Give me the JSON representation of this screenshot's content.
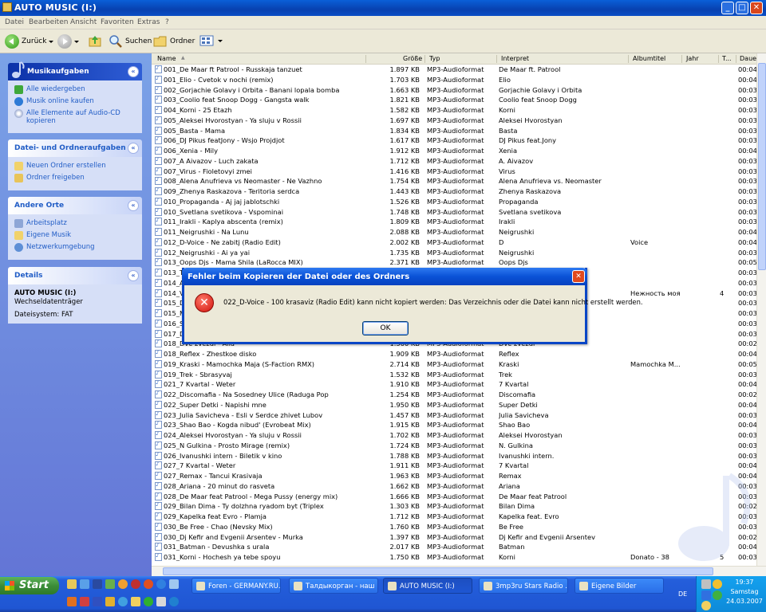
{
  "window": {
    "title": "AUTO MUSIC (I:)",
    "min": "_",
    "max": "□",
    "close": "✕"
  },
  "menu": [
    "Datei",
    "Bearbeiten",
    "Ansicht",
    "Favoriten",
    "Extras",
    "?"
  ],
  "toolbar": {
    "back": "Zurück",
    "search": "Suchen",
    "folders": "Ordner"
  },
  "sidebar": {
    "music": {
      "title": "Musikaufgaben",
      "items": [
        "Alle wiedergeben",
        "Musik online kaufen",
        "Alle Elemente auf Audio-CD kopieren"
      ]
    },
    "files": {
      "title": "Datei- und Ordneraufgaben",
      "items": [
        "Neuen Ordner erstellen",
        "Ordner freigeben"
      ]
    },
    "places": {
      "title": "Andere Orte",
      "items": [
        "Arbeitsplatz",
        "Eigene Musik",
        "Netzwerkumgebung"
      ]
    },
    "details": {
      "title": "Details",
      "name": "AUTO MUSIC (I:)",
      "type": "Wechseldatenträger",
      "fs": "Dateisystem: FAT"
    }
  },
  "columns": {
    "name": "Name",
    "size": "Größe",
    "type": "Typ",
    "interpret": "Interpret",
    "album": "Albumtitel",
    "year": "Jahr",
    "track": "T...",
    "duration": "Daue"
  },
  "files": [
    [
      "001_De Maar ft Patrool - Russkaja tanzuet",
      "1.897 KB",
      "MP3-Audioformat",
      "De Maar ft. Patrool",
      "",
      "",
      "",
      "00:04"
    ],
    [
      "001_Elio - Cvetok v nochi (remix)",
      "1.703 KB",
      "MP3-Audioformat",
      "Elio",
      "",
      "",
      "",
      "00:04"
    ],
    [
      "002_Gorjachie Golavy i Orbita - Banani lopala bomba",
      "1.663 KB",
      "MP3-Audioformat",
      "Gorjachie Golavy i Orbita",
      "",
      "",
      "",
      "00:03"
    ],
    [
      "003_Coolio feat Snoop Dogg - Gangsta walk",
      "1.821 KB",
      "MP3-Audioformat",
      "Coolio feat Snoop Dogg",
      "",
      "",
      "",
      "00:03"
    ],
    [
      "004_Korni - 25 Etazh",
      "1.582 KB",
      "MP3-Audioformat",
      "Korni",
      "",
      "",
      "",
      "00:03"
    ],
    [
      "005_Aleksei Hvorostyan - Ya sluju v Rossii",
      "1.697 KB",
      "MP3-Audioformat",
      "Aleksei Hvorostyan",
      "",
      "",
      "",
      "00:03"
    ],
    [
      "005_Basta - Mama",
      "1.834 KB",
      "MP3-Audioformat",
      "Basta",
      "",
      "",
      "",
      "00:03"
    ],
    [
      "006_DJ Pikus featJony - Wsjo Projdjot",
      "1.617 KB",
      "MP3-Audioformat",
      "DJ Pikus feat.Jony",
      "",
      "",
      "",
      "00:03"
    ],
    [
      "006_Xenia - Mily",
      "1.912 KB",
      "MP3-Audioformat",
      "Xenia",
      "",
      "",
      "",
      "00:04"
    ],
    [
      "007_A Aivazov - Luch zakata",
      "1.712 KB",
      "MP3-Audioformat",
      "A. Aivazov",
      "",
      "",
      "",
      "00:03"
    ],
    [
      "007_Virus - Fioletovyi zmei",
      "1.416 KB",
      "MP3-Audioformat",
      "Virus",
      "",
      "",
      "",
      "00:03"
    ],
    [
      "008_Alena Anufrieva vs Neomaster - Ne Vazhno",
      "1.754 KB",
      "MP3-Audioformat",
      "Alena Anufrieva vs. Neomaster",
      "",
      "",
      "",
      "00:03"
    ],
    [
      "009_Zhenya Raskazova - Teritoria serdca",
      "1.443 KB",
      "MP3-Audioformat",
      "Zhenya Raskazova",
      "",
      "",
      "",
      "00:03"
    ],
    [
      "010_Propaganda - Aj jaj jablotschki",
      "1.526 KB",
      "MP3-Audioformat",
      "Propaganda",
      "",
      "",
      "",
      "00:03"
    ],
    [
      "010_Svetlana svetikova - Vspominai",
      "1.748 KB",
      "MP3-Audioformat",
      "Svetlana svetikova",
      "",
      "",
      "",
      "00:03"
    ],
    [
      "011_Irakli - Kaplya abscenta (remix)",
      "1.809 KB",
      "MP3-Audioformat",
      "Irakli",
      "",
      "",
      "",
      "00:03"
    ],
    [
      "011_Neigrushki - Na Lunu",
      "2.088 KB",
      "MP3-Audioformat",
      "Neigrushki",
      "",
      "",
      "",
      "00:04"
    ],
    [
      "012_D-Voice - Ne zabitj (Radio Edit)",
      "2.002 KB",
      "MP3-Audioformat",
      "D",
      "Voice",
      "",
      "",
      "00:04"
    ],
    [
      "012_Neigrushki - Ai ya yai",
      "1.735 KB",
      "MP3-Audioformat",
      "Neigrushki",
      "",
      "",
      "",
      "00:03"
    ],
    [
      "013_Oops Djs - Mama Shila (LaRocca MIX)",
      "2.371 KB",
      "MP3-Audioformat",
      "Oops Djs",
      "",
      "",
      "",
      "00:05"
    ],
    [
      "013_T",
      "",
      "",
      "",
      "",
      "",
      "",
      "00:03"
    ],
    [
      "014_A",
      "",
      "",
      "",
      "",
      "",
      "",
      "00:03"
    ],
    [
      "014_V",
      "",
      "",
      "",
      "Нежность моя",
      "",
      "4",
      "00:03"
    ],
    [
      "015_D",
      "",
      "",
      "",
      "",
      "",
      "",
      "00:03"
    ],
    [
      "015_M",
      "",
      "",
      "",
      "",
      "",
      "",
      "00:03"
    ],
    [
      "016_S",
      "",
      "",
      "",
      "",
      "",
      "",
      "00:03"
    ],
    [
      "017_D",
      "",
      "",
      "",
      "",
      "",
      "",
      "00:03"
    ],
    [
      "018_Dve zvezdi - Alla",
      "1.360 KB",
      "MP3-Audioformat",
      "Dve zvezdi",
      "",
      "",
      "",
      "00:02"
    ],
    [
      "018_Reflex - Zhestkoe disko",
      "1.909 KB",
      "MP3-Audioformat",
      "Reflex",
      "",
      "",
      "",
      "00:04"
    ],
    [
      "019_Kraski - Mamochka Maja (S-Faction RMX)",
      "2.714 KB",
      "MP3-Audioformat",
      "Kraski",
      "Mamochka M...",
      "",
      "",
      "00:05"
    ],
    [
      "019_Trek - Sbrasyvaj",
      "1.532 KB",
      "MP3-Audioformat",
      "Trek",
      "",
      "",
      "",
      "00:03"
    ],
    [
      "021_7 Kvartal - Weter",
      "1.910 KB",
      "MP3-Audioformat",
      "7 Kvartal",
      "",
      "",
      "",
      "00:04"
    ],
    [
      "022_Discomafia - Na Sosedney Ulice (Raduga Pop",
      "1.254 KB",
      "MP3-Audioformat",
      "Discomafia",
      "",
      "",
      "",
      "00:02"
    ],
    [
      "022_Super Detki - Napishi mne",
      "1.950 KB",
      "MP3-Audioformat",
      "Super Detki",
      "",
      "",
      "",
      "00:04"
    ],
    [
      "023_Julia Savicheva - Esli v Serdce zhivet Lubov",
      "1.457 KB",
      "MP3-Audioformat",
      "Julia Savicheva",
      "",
      "",
      "",
      "00:03"
    ],
    [
      "023_Shao Bao - Kogda nibud' (Evrobeat Mix)",
      "1.915 KB",
      "MP3-Audioformat",
      "Shao Bao",
      "",
      "",
      "",
      "00:04"
    ],
    [
      "024_Aleksei Hvorostyan - Ya sluju v Rossii",
      "1.702 KB",
      "MP3-Audioformat",
      "Aleksei Hvorostyan",
      "",
      "",
      "",
      "00:03"
    ],
    [
      "025_N Gulkina - Prosto Mirage (remix)",
      "1.724 KB",
      "MP3-Audioformat",
      "N. Gulkina",
      "",
      "",
      "",
      "00:03"
    ],
    [
      "026_Ivanushki intern - Biletik v kino",
      "1.788 KB",
      "MP3-Audioformat",
      "Ivanushki intern.",
      "",
      "",
      "",
      "00:03"
    ],
    [
      "027_7 Kvartal - Weter",
      "1.911 KB",
      "MP3-Audioformat",
      "7 Kvartal",
      "",
      "",
      "",
      "00:04"
    ],
    [
      "027_Remax - Tancui Krasivaja",
      "1.963 KB",
      "MP3-Audioformat",
      "Remax",
      "",
      "",
      "",
      "00:04"
    ],
    [
      "028_Ariana - 20 minut do rasveta",
      "1.662 KB",
      "MP3-Audioformat",
      "Ariana",
      "",
      "",
      "",
      "00:03"
    ],
    [
      "028_De Maar feat Patrool - Mega Pussy (energy mix)",
      "1.666 KB",
      "MP3-Audioformat",
      "De Maar feat Patrool",
      "",
      "",
      "",
      "00:03"
    ],
    [
      "029_Bilan Dima - Ty dolzhna ryadom byt (Triplex",
      "1.303 KB",
      "MP3-Audioformat",
      "Bilan Dima",
      "",
      "",
      "",
      "00:02"
    ],
    [
      "029_Kapelka feat Evro - Plamja",
      "1.712 KB",
      "MP3-Audioformat",
      "Kapelka feat. Evro",
      "",
      "",
      "",
      "00:03"
    ],
    [
      "030_Be Free - Chao (Nevsky Mix)",
      "1.760 KB",
      "MP3-Audioformat",
      "Be Free",
      "",
      "",
      "",
      "00:03"
    ],
    [
      "030_Dj Kefir and Evgenii Arsentev - Murka",
      "1.397 KB",
      "MP3-Audioformat",
      "Dj Kefir and Evgenii Arsentev",
      "",
      "",
      "",
      "00:02"
    ],
    [
      "031_Batman - Devushka s urala",
      "2.017 KB",
      "MP3-Audioformat",
      "Batman",
      "",
      "",
      "",
      "00:04"
    ],
    [
      "031_Korni - Hochesh ya tebe spoyu",
      "1.750 KB",
      "MP3-Audioformat",
      "Korni",
      "Donato - 38",
      "",
      "5",
      "00:03"
    ]
  ],
  "dialog": {
    "title": "Fehler beim Kopieren der Datei oder des Ordners",
    "message": "022_D-Voice - 100 krasaviz (Radio Edit) kann nicht kopiert werden: Das Verzeichnis oder die Datei kann nicht erstellt werden.",
    "ok": "OK",
    "close": "✕"
  },
  "taskbar": {
    "start": "Start",
    "tasks": [
      "Foren - GERMANY.RU...",
      "Талдыкорган - наш ...",
      "AUTO MUSIC (I:)",
      "3mp3ru  Stars Radio ...",
      "Eigene Bilder"
    ],
    "lang": "DE",
    "time": "19:37",
    "day": "Samstag",
    "date": "24.03.2007"
  }
}
